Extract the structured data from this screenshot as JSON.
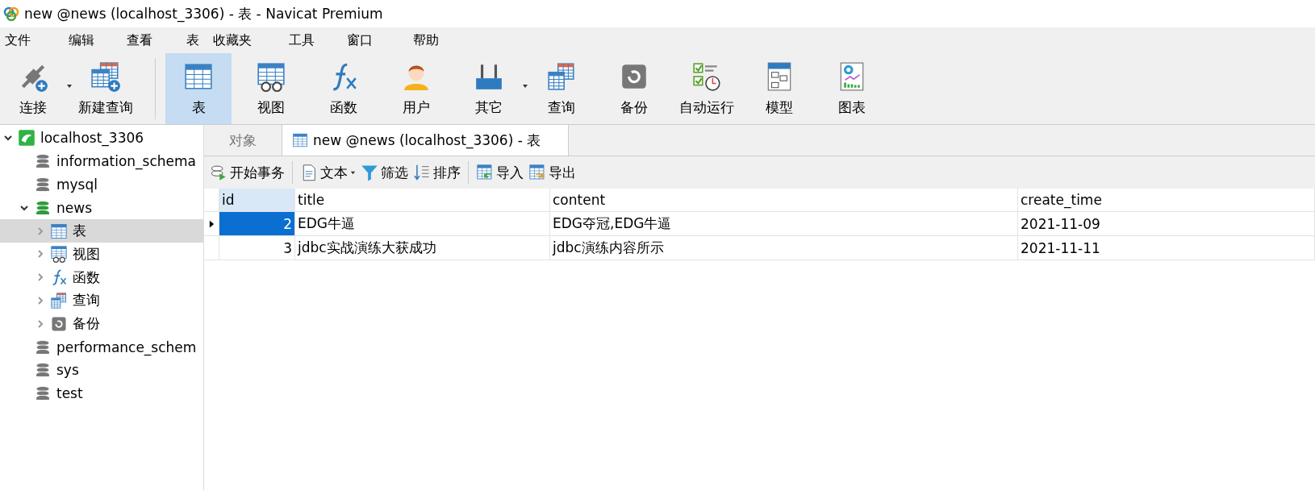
{
  "window": {
    "title": "new @news (localhost_3306) - 表 - Navicat Premium"
  },
  "menu": [
    "文件",
    "编辑",
    "查看",
    "表",
    "收藏夹",
    "工具",
    "窗口",
    "帮助"
  ],
  "toolbar": [
    {
      "kind": "connect",
      "label": "连接",
      "selected": false,
      "dropdown": true
    },
    {
      "kind": "new-query",
      "label": "新建查询",
      "selected": false,
      "dropdown": false
    },
    {
      "kind": "table",
      "label": "表",
      "selected": true,
      "dropdown": false
    },
    {
      "kind": "view",
      "label": "视图",
      "selected": false,
      "dropdown": false
    },
    {
      "kind": "function",
      "label": "函数",
      "selected": false,
      "dropdown": false
    },
    {
      "kind": "user",
      "label": "用户",
      "selected": false,
      "dropdown": false
    },
    {
      "kind": "other",
      "label": "其它",
      "selected": false,
      "dropdown": true
    },
    {
      "kind": "query",
      "label": "查询",
      "selected": false,
      "dropdown": false
    },
    {
      "kind": "backup",
      "label": "备份",
      "selected": false,
      "dropdown": false
    },
    {
      "kind": "autorun",
      "label": "自动运行",
      "selected": false,
      "dropdown": false
    },
    {
      "kind": "model",
      "label": "模型",
      "selected": false,
      "dropdown": false
    },
    {
      "kind": "chart",
      "label": "图表",
      "selected": false,
      "dropdown": false
    }
  ],
  "sidebar": {
    "items": [
      {
        "kind": "server",
        "label": "localhost_3306",
        "expanded": true,
        "selected": false,
        "children": [
          {
            "kind": "database",
            "label": "information_schema",
            "opened": false,
            "selected": false
          },
          {
            "kind": "database",
            "label": "mysql",
            "opened": false,
            "selected": false
          },
          {
            "kind": "database",
            "label": "news",
            "opened": true,
            "expanded": true,
            "selected": false,
            "children": [
              {
                "kind": "table",
                "label": "表",
                "expanded": false,
                "selected": true
              },
              {
                "kind": "view",
                "label": "视图",
                "expanded": false,
                "selected": false
              },
              {
                "kind": "function",
                "label": "函数",
                "expanded": false,
                "selected": false
              },
              {
                "kind": "query",
                "label": "查询",
                "expanded": false,
                "selected": false
              },
              {
                "kind": "backup",
                "label": "备份",
                "expanded": false,
                "selected": false
              }
            ]
          },
          {
            "kind": "database",
            "label": "performance_schem",
            "opened": false,
            "selected": false
          },
          {
            "kind": "database",
            "label": "sys",
            "opened": false,
            "selected": false
          },
          {
            "kind": "database",
            "label": "test",
            "opened": false,
            "selected": false
          }
        ]
      }
    ]
  },
  "tabs": [
    {
      "label": "对象",
      "selected": false,
      "icon": false
    },
    {
      "label": "new @news (localhost_3306) - 表",
      "selected": true,
      "icon": true
    }
  ],
  "actions": [
    {
      "kind": "transaction",
      "label": "开始事务",
      "dropdown": false
    },
    {
      "kind": "text",
      "label": "文本",
      "dropdown": true
    },
    {
      "kind": "filter",
      "label": "筛选",
      "dropdown": false
    },
    {
      "kind": "sort",
      "label": "排序",
      "dropdown": false
    },
    {
      "kind": "import",
      "label": "导入",
      "dropdown": false
    },
    {
      "kind": "export",
      "label": "导出",
      "dropdown": false
    }
  ],
  "table": {
    "columns": [
      {
        "label": "id",
        "selected": true
      },
      {
        "label": "title",
        "selected": false
      },
      {
        "label": "content",
        "selected": false
      },
      {
        "label": "create_time",
        "selected": false
      }
    ],
    "rows": [
      {
        "selected": true,
        "cells": [
          "2",
          "EDG牛逼",
          "EDG夺冠,EDG牛逼",
          "2021-11-09"
        ]
      },
      {
        "selected": false,
        "cells": [
          "3",
          "jdbc实战演练大获成功",
          "jdbc演练内容所示",
          "2021-11-11"
        ]
      }
    ]
  }
}
